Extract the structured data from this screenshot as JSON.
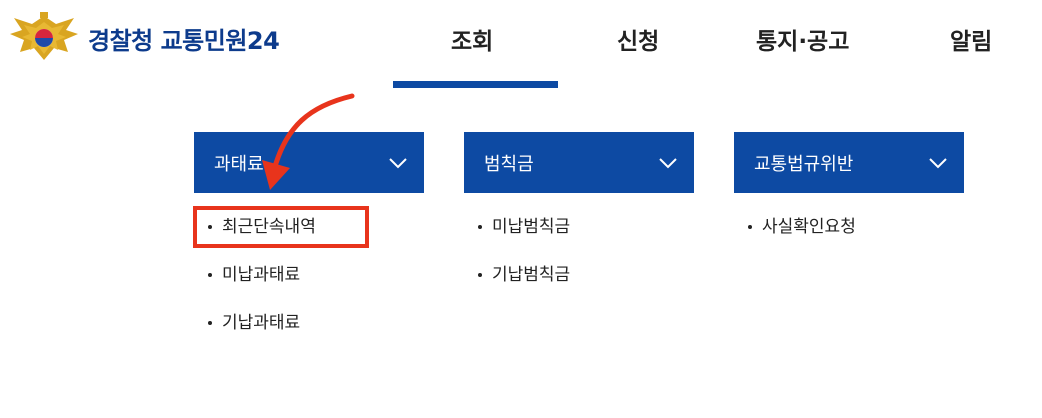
{
  "header": {
    "logo_text": "경찰청 교통민원24",
    "logo_icon": "police-emblem-icon",
    "nav": [
      {
        "label": "조회",
        "active": true
      },
      {
        "label": "신청",
        "active": false
      },
      {
        "label": "통지·공고",
        "active": false
      },
      {
        "label": "알림",
        "active": false
      }
    ]
  },
  "menu": [
    {
      "title": "과태료",
      "icon": "chevron-down-icon",
      "items": [
        "최근단속내역",
        "미납과태료",
        "기납과태료"
      ]
    },
    {
      "title": "범칙금",
      "icon": "chevron-down-icon",
      "items": [
        "미납범칙금",
        "기납범칙금"
      ]
    },
    {
      "title": "교통법규위반",
      "icon": "chevron-down-icon",
      "items": [
        "사실확인요청"
      ]
    }
  ],
  "annotation": {
    "highlighted_item": "최근단속내역",
    "arrow_icon": "curved-arrow-icon"
  },
  "colors": {
    "brand_blue": "#0d4aa3",
    "logo_text": "#0d3b8c",
    "annotation_red": "#e8341c"
  }
}
